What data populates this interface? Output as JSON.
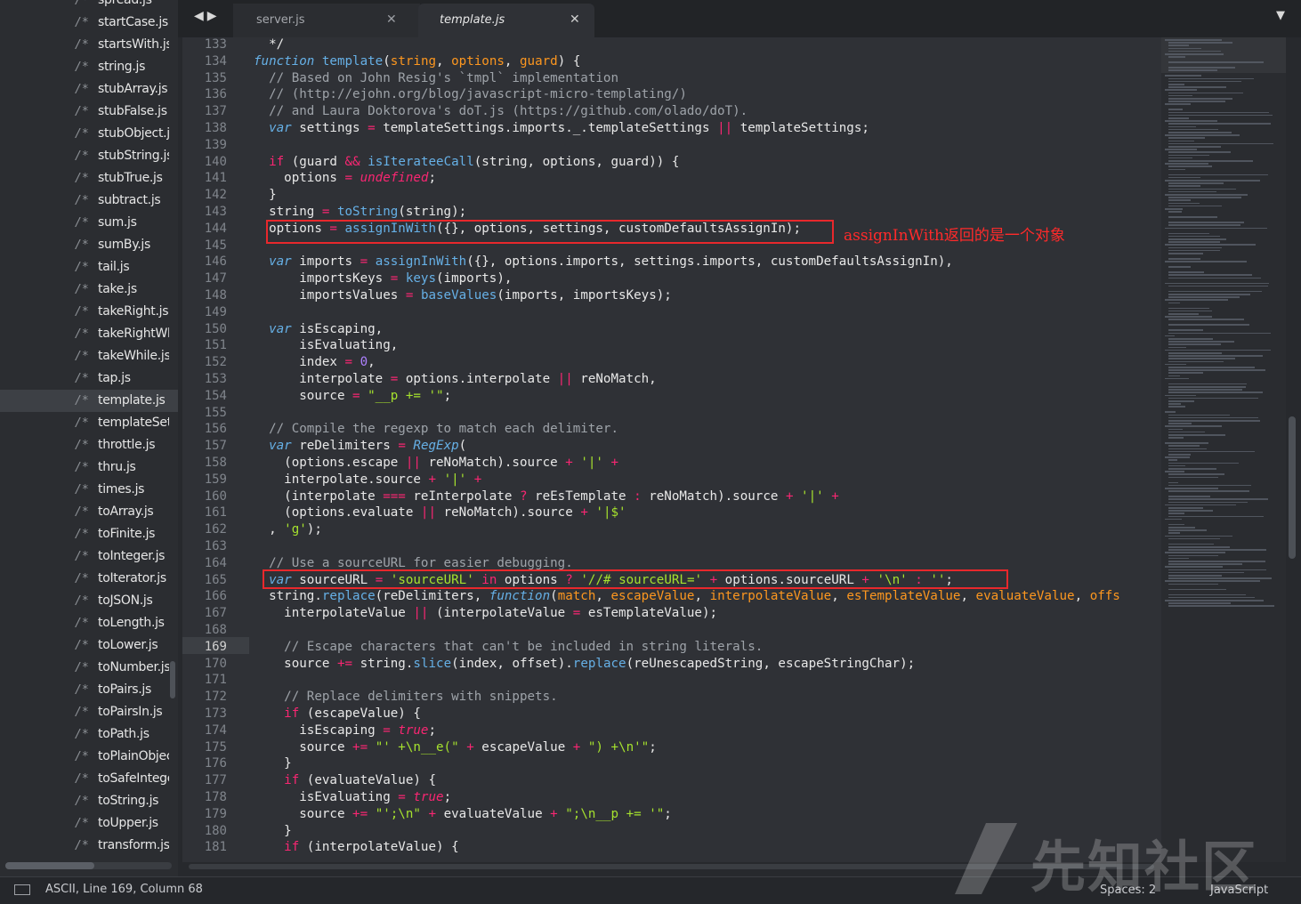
{
  "tabs": [
    {
      "label": "server.js",
      "active": false
    },
    {
      "label": "template.js",
      "active": true
    }
  ],
  "sidebar": {
    "items": [
      {
        "icon": "/*",
        "label": "spread.js"
      },
      {
        "icon": "/*",
        "label": "startCase.js"
      },
      {
        "icon": "/*",
        "label": "startsWith.js"
      },
      {
        "icon": "/*",
        "label": "string.js"
      },
      {
        "icon": "/*",
        "label": "stubArray.js"
      },
      {
        "icon": "/*",
        "label": "stubFalse.js"
      },
      {
        "icon": "/*",
        "label": "stubObject.js"
      },
      {
        "icon": "/*",
        "label": "stubString.js"
      },
      {
        "icon": "/*",
        "label": "stubTrue.js"
      },
      {
        "icon": "/*",
        "label": "subtract.js"
      },
      {
        "icon": "/*",
        "label": "sum.js"
      },
      {
        "icon": "/*",
        "label": "sumBy.js"
      },
      {
        "icon": "/*",
        "label": "tail.js"
      },
      {
        "icon": "/*",
        "label": "take.js"
      },
      {
        "icon": "/*",
        "label": "takeRight.js"
      },
      {
        "icon": "/*",
        "label": "takeRightWhile.js"
      },
      {
        "icon": "/*",
        "label": "takeWhile.js"
      },
      {
        "icon": "/*",
        "label": "tap.js"
      },
      {
        "icon": "/*",
        "label": "template.js",
        "selected": true
      },
      {
        "icon": "/*",
        "label": "templateSettings.js"
      },
      {
        "icon": "/*",
        "label": "throttle.js"
      },
      {
        "icon": "/*",
        "label": "thru.js"
      },
      {
        "icon": "/*",
        "label": "times.js"
      },
      {
        "icon": "/*",
        "label": "toArray.js"
      },
      {
        "icon": "/*",
        "label": "toFinite.js"
      },
      {
        "icon": "/*",
        "label": "toInteger.js"
      },
      {
        "icon": "/*",
        "label": "toIterator.js"
      },
      {
        "icon": "/*",
        "label": "toJSON.js"
      },
      {
        "icon": "/*",
        "label": "toLength.js"
      },
      {
        "icon": "/*",
        "label": "toLower.js"
      },
      {
        "icon": "/*",
        "label": "toNumber.js"
      },
      {
        "icon": "/*",
        "label": "toPairs.js"
      },
      {
        "icon": "/*",
        "label": "toPairsIn.js"
      },
      {
        "icon": "/*",
        "label": "toPath.js"
      },
      {
        "icon": "/*",
        "label": "toPlainObject.js"
      },
      {
        "icon": "/*",
        "label": "toSafeInteger.js"
      },
      {
        "icon": "/*",
        "label": "toString.js"
      },
      {
        "icon": "/*",
        "label": "toUpper.js"
      },
      {
        "icon": "/*",
        "label": "transform.js"
      }
    ]
  },
  "editor": {
    "active_line": 169,
    "lines": [
      {
        "n": 133,
        "html": "  */"
      },
      {
        "n": 134,
        "html": "<span class='sk'>function</span> <span class='fn'>template</span>(<span class='pm'>string</span>, <span class='pm'>options</span>, <span class='pm'>guard</span>) {"
      },
      {
        "n": 135,
        "html": "  <span class='cm'>// Based on John Resig's `tmpl` implementation</span>"
      },
      {
        "n": 136,
        "html": "  <span class='cm'>// (http://ejohn.org/blog/javascript-micro-templating/)</span>"
      },
      {
        "n": 137,
        "html": "  <span class='cm'>// and Laura Doktorova's doT.js (https://github.com/olado/doT).</span>"
      },
      {
        "n": 138,
        "html": "  <span class='sk'>var</span> settings <span class='op'>=</span> templateSettings.imports._.templateSettings <span class='op'>||</span> templateSettings;"
      },
      {
        "n": 139,
        "html": ""
      },
      {
        "n": 140,
        "html": "  <span class='kw'>if</span> (guard <span class='op'>&amp;&amp;</span> <span class='fn'>isIterateeCall</span>(string, options, guard)) {"
      },
      {
        "n": 141,
        "html": "    options <span class='op'>=</span> <span class='cons'>undefined</span>;"
      },
      {
        "n": 142,
        "html": "  }"
      },
      {
        "n": 143,
        "html": "  string <span class='op'>=</span> <span class='fn'>toString</span>(string);"
      },
      {
        "n": 144,
        "html": "  options <span class='op'>=</span> <span class='fn'>assignInWith</span>({}, options, settings, customDefaultsAssignIn);"
      },
      {
        "n": 145,
        "html": ""
      },
      {
        "n": 146,
        "html": "  <span class='sk'>var</span> imports <span class='op'>=</span> <span class='fn'>assignInWith</span>({}, options.imports, settings.imports, customDefaultsAssignIn),"
      },
      {
        "n": 147,
        "html": "      importsKeys <span class='op'>=</span> <span class='fn'>keys</span>(imports),"
      },
      {
        "n": 148,
        "html": "      importsValues <span class='op'>=</span> <span class='fn'>baseValues</span>(imports, importsKeys);"
      },
      {
        "n": 149,
        "html": ""
      },
      {
        "n": 150,
        "html": "  <span class='sk'>var</span> isEscaping,"
      },
      {
        "n": 151,
        "html": "      isEvaluating,"
      },
      {
        "n": 152,
        "html": "      index <span class='op'>=</span> <span class='nm'>0</span>,"
      },
      {
        "n": 153,
        "html": "      interpolate <span class='op'>=</span> options.interpolate <span class='op'>||</span> reNoMatch,"
      },
      {
        "n": 154,
        "html": "      source <span class='op'>=</span> <span class='st'>\"__p += '\"</span>;"
      },
      {
        "n": 155,
        "html": ""
      },
      {
        "n": 156,
        "html": "  <span class='cm'>// Compile the regexp to match each delimiter.</span>"
      },
      {
        "n": 157,
        "html": "  <span class='sk'>var</span> reDelimiters <span class='op'>=</span> <span class='sk'>RegExp</span>("
      },
      {
        "n": 158,
        "html": "    (options.escape <span class='op'>||</span> reNoMatch).source <span class='op'>+</span> <span class='st'>'|'</span> <span class='op'>+</span>"
      },
      {
        "n": 159,
        "html": "    interpolate.source <span class='op'>+</span> <span class='st'>'|'</span> <span class='op'>+</span>"
      },
      {
        "n": 160,
        "html": "    (interpolate <span class='op'>===</span> reInterpolate <span class='op'>?</span> reEsTemplate <span class='op'>:</span> reNoMatch).source <span class='op'>+</span> <span class='st'>'|'</span> <span class='op'>+</span>"
      },
      {
        "n": 161,
        "html": "    (options.evaluate <span class='op'>||</span> reNoMatch).source <span class='op'>+</span> <span class='st'>'|$'</span>"
      },
      {
        "n": 162,
        "html": "  , <span class='st'>'g'</span>);"
      },
      {
        "n": 163,
        "html": ""
      },
      {
        "n": 164,
        "html": "  <span class='cm'>// Use a sourceURL for easier debugging.</span>"
      },
      {
        "n": 165,
        "html": "  <span class='sk'>var</span> sourceURL <span class='op'>=</span> <span class='st'>'sourceURL'</span> <span class='kw'>in</span> options <span class='op'>?</span> <span class='st'>'//# sourceURL='</span> <span class='op'>+</span> options.sourceURL <span class='op'>+</span> <span class='st'>'\\n'</span> <span class='op'>:</span> <span class='st'>''</span>;"
      },
      {
        "n": 166,
        "html": "  string.<span class='fn'>replace</span>(reDelimiters, <span class='sk'>function</span>(<span class='pm'>match</span>, <span class='pm'>escapeValue</span>, <span class='pm'>interpolateValue</span>, <span class='pm'>esTemplateValue</span>, <span class='pm'>evaluateValue</span>, <span class='pm'>offs</span>"
      },
      {
        "n": 167,
        "html": "    interpolateValue <span class='op'>||</span> (interpolateValue <span class='op'>=</span> esTemplateValue);"
      },
      {
        "n": 168,
        "html": ""
      },
      {
        "n": 169,
        "html": "    <span class='cm'>// Escape characters that can't be included in string literals.</span>"
      },
      {
        "n": 170,
        "html": "    source <span class='op'>+=</span> string.<span class='fn'>slice</span>(index, offset).<span class='fn'>replace</span>(reUnescapedString, escapeStringChar);"
      },
      {
        "n": 171,
        "html": ""
      },
      {
        "n": 172,
        "html": "    <span class='cm'>// Replace delimiters with snippets.</span>"
      },
      {
        "n": 173,
        "html": "    <span class='kw'>if</span> (escapeValue) {"
      },
      {
        "n": 174,
        "html": "      isEscaping <span class='op'>=</span> <span class='cons'>true</span>;"
      },
      {
        "n": 175,
        "html": "      source <span class='op'>+=</span> <span class='st'>\"' +\\n__e(\"</span> <span class='op'>+</span> escapeValue <span class='op'>+</span> <span class='st'>\") +\\n'\"</span>;"
      },
      {
        "n": 176,
        "html": "    }"
      },
      {
        "n": 177,
        "html": "    <span class='kw'>if</span> (evaluateValue) {"
      },
      {
        "n": 178,
        "html": "      isEvaluating <span class='op'>=</span> <span class='cons'>true</span>;"
      },
      {
        "n": 179,
        "html": "      source <span class='op'>+=</span> <span class='st'>\"';\\n\"</span> <span class='op'>+</span> evaluateValue <span class='op'>+</span> <span class='st'>\";\\n__p += '\"</span>;"
      },
      {
        "n": 180,
        "html": "    }"
      },
      {
        "n": 181,
        "html": "    <span class='kw'>if</span> (interpolateValue) {"
      }
    ]
  },
  "annotation": {
    "text": "assignInWith返回的是一个对象",
    "color": "#ff2a2a"
  },
  "status": {
    "position": "ASCII, Line 169, Column 68",
    "spaces": "Spaces: 2",
    "syntax": "JavaScript"
  },
  "watermark": {
    "text": "先知社区"
  },
  "colors": {
    "keyword": "#f92672",
    "storage": "#66b0e6",
    "string": "#a6e22e",
    "param": "#fd971f",
    "highlight_box": "#e8282c"
  }
}
